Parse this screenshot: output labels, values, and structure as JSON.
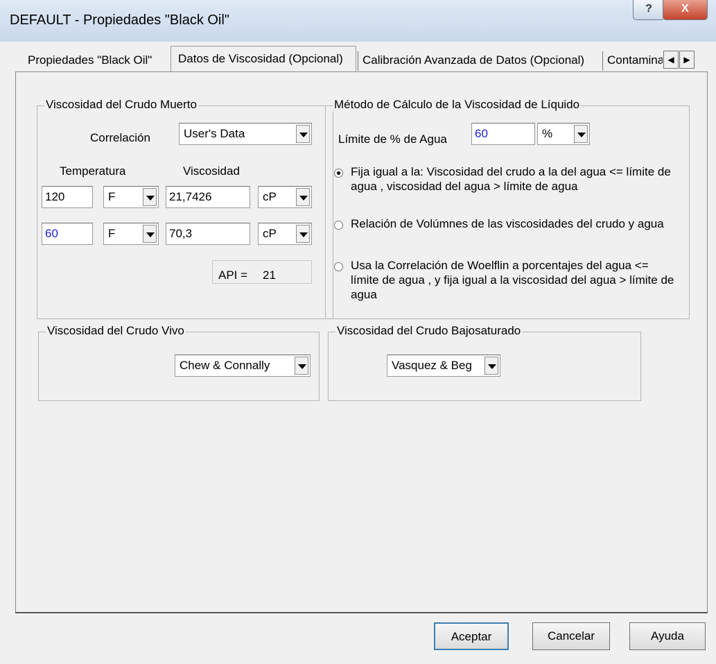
{
  "window": {
    "title": "DEFAULT - Propiedades \"Black Oil\"",
    "help_label": "?",
    "close_label": "X"
  },
  "tabs": [
    {
      "label": "Propiedades \"Black Oil\"",
      "active": false
    },
    {
      "label": "Datos de Viscosidad (Opcional)",
      "active": true
    },
    {
      "label": "Calibración Avanzada de Datos (Opcional)",
      "active": false
    },
    {
      "label": "Contamina",
      "active": false
    }
  ],
  "tab_scroll": {
    "left": "◀",
    "right": "▶"
  },
  "dead_oil": {
    "title": "Viscosidad del Crudo Muerto",
    "correlation_label": "Correlación",
    "correlation_value": "User's Data",
    "temperature_header": "Temperatura",
    "viscosity_header": "Viscosidad",
    "rows": [
      {
        "temperature": "120",
        "temp_unit": "F",
        "viscosity": "21,7426",
        "visc_unit": "cP"
      },
      {
        "temperature": "60",
        "temp_unit": "F",
        "viscosity": "70,3",
        "visc_unit": "cP"
      }
    ],
    "api_label": "API =",
    "api_value": "21"
  },
  "liquid_method": {
    "title": "Método de Cálculo de la Viscosidad de Líquido",
    "water_limit_label": "Límite de % de Agua",
    "water_limit_value": "60",
    "water_limit_unit": "%",
    "options": [
      {
        "text": "Fija igual  a la: Viscosidad del crudo a la del agua <= límite de agua , viscosidad del agua > límite de agua",
        "checked": true
      },
      {
        "text": "Relación de Volúmnes de las viscosidades del crudo y agua",
        "checked": false
      },
      {
        "text": "Usa la Correlación de Woelflin a porcentajes del agua <= límite de agua , y fija igual a la viscosidad del agua > límite de agua",
        "checked": false
      }
    ]
  },
  "live_oil": {
    "title": "Viscosidad del Crudo Vivo",
    "value": "Chew & Connally"
  },
  "undersaturated": {
    "title": "Viscosidad del Crudo Bajosaturado",
    "value": "Vasquez & Beg"
  },
  "buttons": {
    "ok": "Aceptar",
    "cancel": "Cancelar",
    "help": "Ayuda"
  },
  "colors": {
    "accent_text": "#2222cc",
    "close_button": "#c5432b"
  }
}
